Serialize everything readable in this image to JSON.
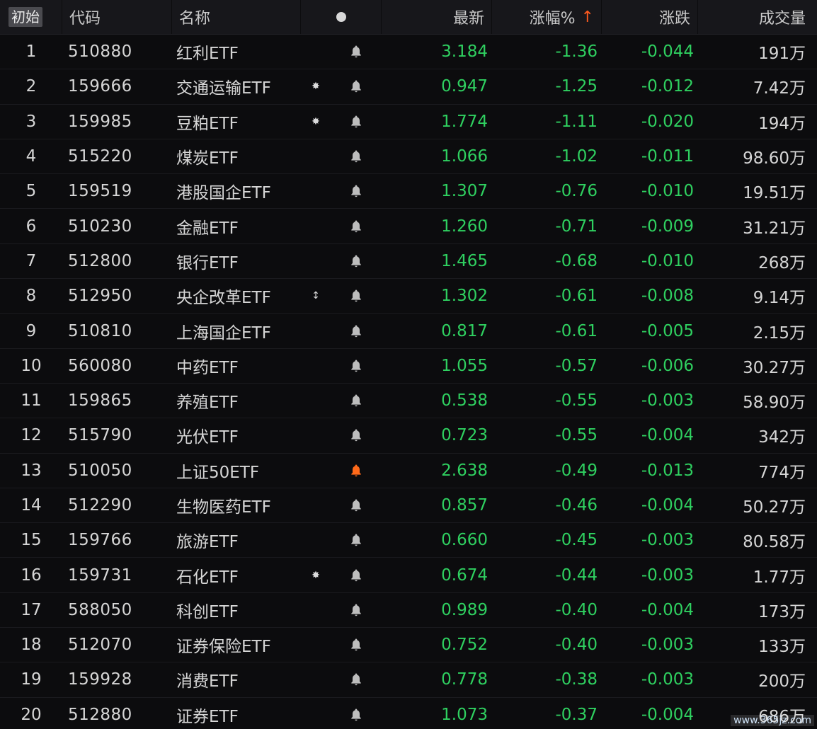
{
  "header": {
    "reset_label": "初始",
    "code_label": "代码",
    "name_label": "名称",
    "latest_label": "最新",
    "pct_label": "涨幅%",
    "sort_arrow": "↑",
    "change_label": "涨跌",
    "volume_label": "成交量"
  },
  "colors": {
    "down_green": "#2fd060",
    "bell_gray": "#bdbdbd",
    "bell_orange": "#ff6a1a",
    "accent_orange": "#ff5a1f"
  },
  "rows": [
    {
      "idx": "1",
      "code": "510880",
      "name": "红利ETF",
      "mark": "",
      "bell": "gray",
      "price": "3.184",
      "pct": "-1.36",
      "chg": "-0.044",
      "vol": "191万"
    },
    {
      "idx": "2",
      "code": "159666",
      "name": "交通运输ETF",
      "mark": "✸",
      "bell": "gray",
      "price": "0.947",
      "pct": "-1.25",
      "chg": "-0.012",
      "vol": "7.42万"
    },
    {
      "idx": "3",
      "code": "159985",
      "name": "豆粕ETF",
      "mark": "✸",
      "bell": "gray",
      "price": "1.774",
      "pct": "-1.11",
      "chg": "-0.020",
      "vol": "194万"
    },
    {
      "idx": "4",
      "code": "515220",
      "name": "煤炭ETF",
      "mark": "",
      "bell": "gray",
      "price": "1.066",
      "pct": "-1.02",
      "chg": "-0.011",
      "vol": "98.60万"
    },
    {
      "idx": "5",
      "code": "159519",
      "name": "港股国企ETF",
      "mark": "",
      "bell": "gray",
      "price": "1.307",
      "pct": "-0.76",
      "chg": "-0.010",
      "vol": "19.51万"
    },
    {
      "idx": "6",
      "code": "510230",
      "name": "金融ETF",
      "mark": "",
      "bell": "gray",
      "price": "1.260",
      "pct": "-0.71",
      "chg": "-0.009",
      "vol": "31.21万"
    },
    {
      "idx": "7",
      "code": "512800",
      "name": "银行ETF",
      "mark": "",
      "bell": "gray",
      "price": "1.465",
      "pct": "-0.68",
      "chg": "-0.010",
      "vol": "268万"
    },
    {
      "idx": "8",
      "code": "512950",
      "name": "央企改革ETF",
      "mark": "↕",
      "bell": "gray",
      "price": "1.302",
      "pct": "-0.61",
      "chg": "-0.008",
      "vol": "9.14万"
    },
    {
      "idx": "9",
      "code": "510810",
      "name": "上海国企ETF",
      "mark": "",
      "bell": "gray",
      "price": "0.817",
      "pct": "-0.61",
      "chg": "-0.005",
      "vol": "2.15万"
    },
    {
      "idx": "10",
      "code": "560080",
      "name": "中药ETF",
      "mark": "",
      "bell": "gray",
      "price": "1.055",
      "pct": "-0.57",
      "chg": "-0.006",
      "vol": "30.27万"
    },
    {
      "idx": "11",
      "code": "159865",
      "name": "养殖ETF",
      "mark": "",
      "bell": "gray",
      "price": "0.538",
      "pct": "-0.55",
      "chg": "-0.003",
      "vol": "58.90万"
    },
    {
      "idx": "12",
      "code": "515790",
      "name": "光伏ETF",
      "mark": "",
      "bell": "gray",
      "price": "0.723",
      "pct": "-0.55",
      "chg": "-0.004",
      "vol": "342万"
    },
    {
      "idx": "13",
      "code": "510050",
      "name": "上证50ETF",
      "mark": "",
      "bell": "orange",
      "price": "2.638",
      "pct": "-0.49",
      "chg": "-0.013",
      "vol": "774万"
    },
    {
      "idx": "14",
      "code": "512290",
      "name": "生物医药ETF",
      "mark": "",
      "bell": "gray",
      "price": "0.857",
      "pct": "-0.46",
      "chg": "-0.004",
      "vol": "50.27万"
    },
    {
      "idx": "15",
      "code": "159766",
      "name": "旅游ETF",
      "mark": "",
      "bell": "gray",
      "price": "0.660",
      "pct": "-0.45",
      "chg": "-0.003",
      "vol": "80.58万"
    },
    {
      "idx": "16",
      "code": "159731",
      "name": "石化ETF",
      "mark": "✸",
      "bell": "gray",
      "price": "0.674",
      "pct": "-0.44",
      "chg": "-0.003",
      "vol": "1.77万"
    },
    {
      "idx": "17",
      "code": "588050",
      "name": "科创ETF",
      "mark": "",
      "bell": "gray",
      "price": "0.989",
      "pct": "-0.40",
      "chg": "-0.004",
      "vol": "173万"
    },
    {
      "idx": "18",
      "code": "512070",
      "name": "证券保险ETF",
      "mark": "",
      "bell": "gray",
      "price": "0.752",
      "pct": "-0.40",
      "chg": "-0.003",
      "vol": "133万"
    },
    {
      "idx": "19",
      "code": "159928",
      "name": "消费ETF",
      "mark": "",
      "bell": "gray",
      "price": "0.778",
      "pct": "-0.38",
      "chg": "-0.003",
      "vol": "200万"
    },
    {
      "idx": "20",
      "code": "512880",
      "name": "证券ETF",
      "mark": "",
      "bell": "gray",
      "price": "1.073",
      "pct": "-0.37",
      "chg": "-0.004",
      "vol": "686万"
    }
  ],
  "watermark": "www.365jz.com"
}
